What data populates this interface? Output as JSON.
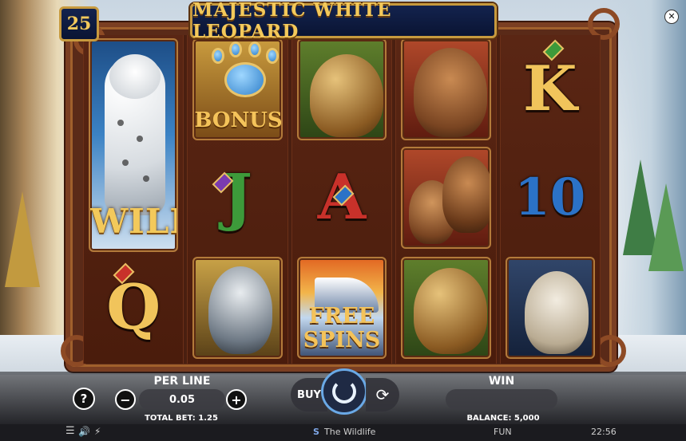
{
  "game": {
    "title": "MAJESTIC WHITE LEOPARD",
    "lines": "25"
  },
  "reels": {
    "wild_label": "WILD",
    "bonus_label": "BONUS",
    "free_spins_label_1": "FREE",
    "free_spins_label_2": "SPINS",
    "letters": {
      "k": "K",
      "j": "J",
      "a": "A",
      "ten": "10",
      "q": "Q"
    }
  },
  "controls": {
    "help_label": "?",
    "per_line_label": "PER LINE",
    "per_line_value": "0.05",
    "minus_label": "−",
    "plus_label": "+",
    "total_bet_label": "TOTAL BET: 1.25",
    "buy_label": "BUY",
    "win_label": "WIN",
    "balance_label": "BALANCE: 5,000"
  },
  "statusbar": {
    "game_name": "The Wildlife",
    "mode": "FUN",
    "clock": "22:56"
  },
  "icons": {
    "close": "close-icon",
    "menu": "menu-icon",
    "sound": "sound-icon",
    "turbo": "turbo-icon"
  },
  "colors": {
    "gold": "#f3c95b",
    "frame": "#5a2a18",
    "banner": "#13234e",
    "spin_accent": "#6aa9e6"
  }
}
